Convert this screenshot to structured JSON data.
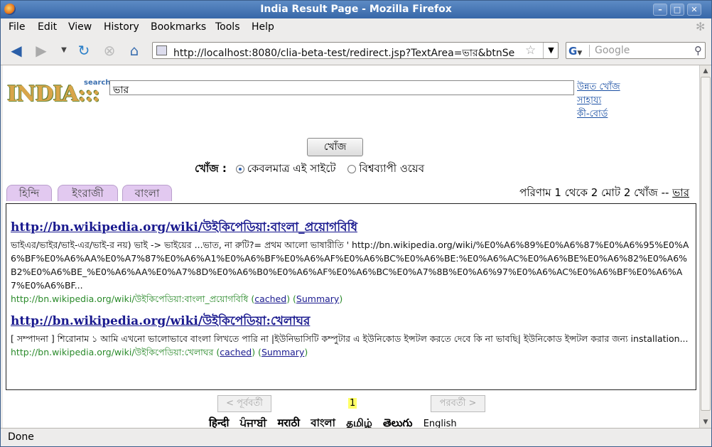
{
  "window": {
    "title": "India Result Page - Mozilla Firefox"
  },
  "menu": [
    "File",
    "Edit",
    "View",
    "History",
    "Bookmarks",
    "Tools",
    "Help"
  ],
  "nav": {
    "url": "http://localhost:8080/clia-beta-test/redirect.jsp?TextArea=ভার&btnSe",
    "search_placeholder": "Google"
  },
  "page": {
    "logo": {
      "word": "INDIA:::",
      "tag": "search"
    },
    "query": "ভার",
    "side_links": [
      "উন্নত খোঁজ",
      "সাহায্য",
      "কী-বোর্ড"
    ],
    "search_button": "খোঁজ",
    "scope": {
      "label": "খোঁজ :",
      "option_site": "কেবলমাত্র এই সাইটে",
      "option_web": "বিশ্বব্যাপী ওয়েব"
    },
    "tabs": [
      "হিন্দি",
      "ইংরাজী",
      "বাংলা"
    ],
    "result_info": {
      "text": "পরিণাম 1 থেকে 2 মোট 2 খোঁজ --",
      "term": "ভার"
    },
    "results": [
      {
        "title": "http://bn.wikipedia.org/wiki/উইকিপেডিয়া:বাংলা_প্রয়োগবিধি",
        "snippet": "ভাইএর/ভাইর/ভাই-এর/ভাই-র নয়) ভাই -> ভাইয়ের ...ভাত, না রুটি?= প্রথম আলো ভাষারীতি ' http://bn.wikipedia.org/wiki/%E0%A6%89%E0%A6%87%E0%A6%95%E0%A6%BF%E0%A6%AA%E0%A7%87%E0%A6%A1%E0%A6%BF%E0%A6%AF%E0%A6%BC%E0%A6%BE:%E0%A6%AC%E0%A6%BE%E0%A6%82%E0%A6%B2%E0%A6%BE_%E0%A6%AA%E0%A7%8D%E0%A6%B0%E0%A6%AF%E0%A6%BC%E0%A7%8B%E0%A6%97%E0%A6%AC%E0%A6%BF%E0%A6%A7%E0%A6%BF...",
        "url": "http://bn.wikipedia.org/wiki/উইকিপেডিয়া:বাংলা_প্রয়োগবিধি",
        "cached": "cached",
        "summary": "Summary"
      },
      {
        "title": "http://bn.wikipedia.org/wiki/উইকিপেডিয়া:খেলাঘর",
        "snippet": "[ সম্পাদনা ] শিরোনাম ১ আমি এখনো ভালোভাবে বাংলা লিখতে পারি না |ইউনিভাসিটি কম্পুটার এ ইউনিকোড ইন্সটল করতে দেবে কি না ভাবছি| ইউনিকোড ইন্সটল করার জন্য installation...",
        "url": "http://bn.wikipedia.org/wiki/উইকিপেডিয়া:খেলাঘর",
        "cached": "cached",
        "summary": "Summary"
      }
    ],
    "pager": {
      "prev": "< পূর্ববর্তী",
      "next": "পরবর্তী >",
      "current": "1"
    },
    "languages": [
      "हिन्दी",
      "ਪੰਜਾਬੀ",
      "मराठी",
      "বাংলা",
      "தமிழ்",
      "తెలుగు",
      "English"
    ]
  },
  "status": "Done"
}
